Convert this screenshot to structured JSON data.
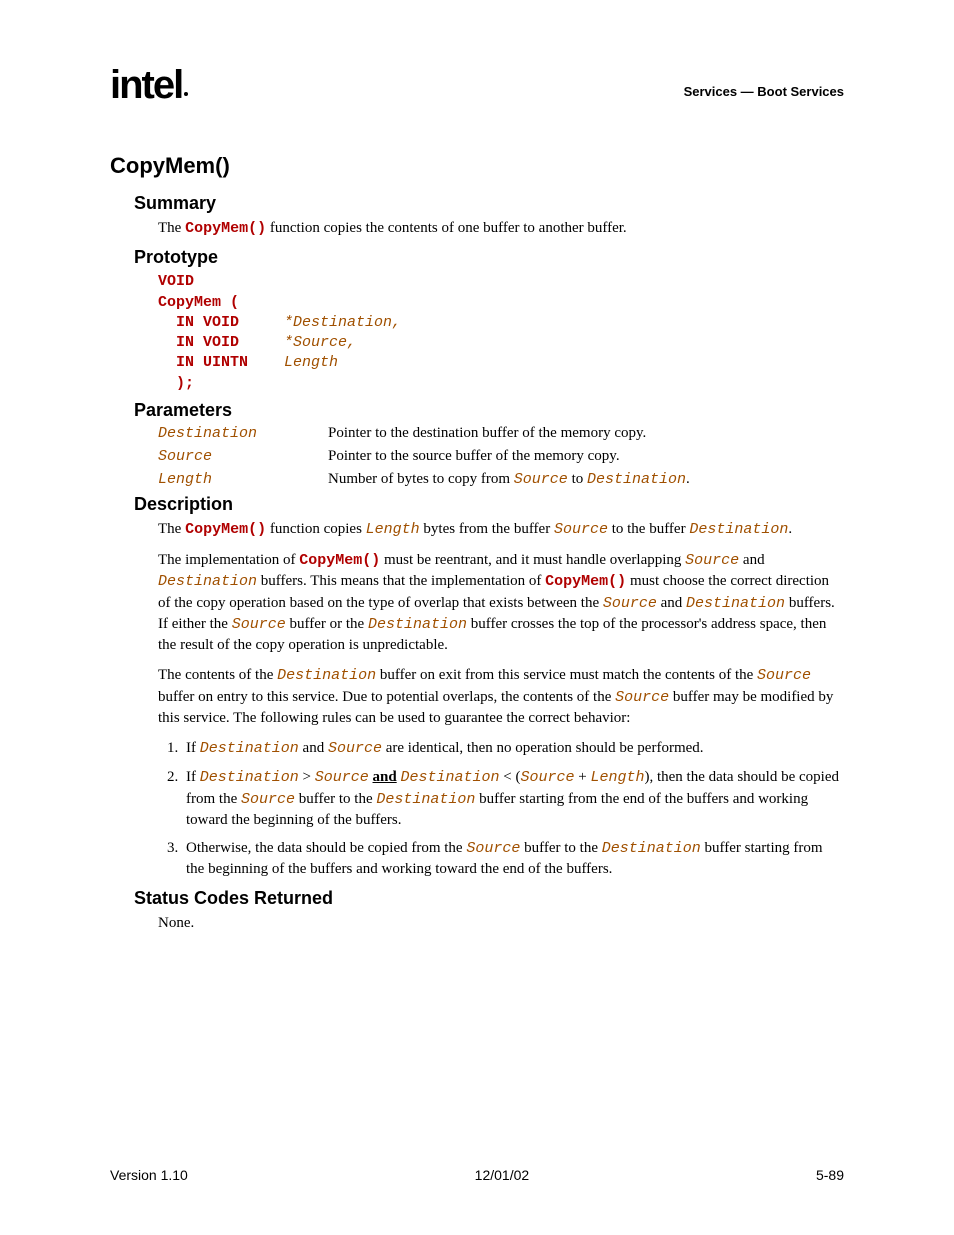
{
  "header": {
    "logo_text": "intel",
    "right_text": "Services — Boot Services"
  },
  "title": "CopyMem()",
  "summary": {
    "heading": "Summary",
    "prefix": "The ",
    "fn": "CopyMem()",
    "suffix": " function copies the contents of one buffer to another buffer."
  },
  "prototype": {
    "heading": "Prototype",
    "l1_kw": "VOID",
    "l2_kw": "CopyMem (",
    "l3_kw": "  IN VOID",
    "l3_id": "*Destination,",
    "l4_kw": "  IN VOID",
    "l4_id": "*Source,",
    "l5_kw": "  IN UINTN",
    "l5_id": "Length",
    "l6_kw": "  );"
  },
  "parameters": {
    "heading": "Parameters",
    "rows": [
      {
        "name": "Destination",
        "desc": "Pointer to the destination buffer of the memory copy."
      },
      {
        "name": "Source",
        "desc": "Pointer to the source buffer of the memory copy."
      },
      {
        "name": "Length",
        "desc_prefix": "Number of bytes to copy from ",
        "a": "Source",
        "mid": " to ",
        "b": "Destination",
        "end": "."
      }
    ]
  },
  "description": {
    "heading": "Description",
    "p1": {
      "t1": "The ",
      "fn": "CopyMem()",
      "t2": " function copies ",
      "len": "Length",
      "t3": " bytes from the buffer ",
      "src": "Source",
      "t4": " to the buffer ",
      "dst": "Destination",
      "t5": "."
    },
    "p2": {
      "t1": "The implementation of ",
      "fn1": "CopyMem()",
      "t2": " must be reentrant, and it must handle overlapping ",
      "src": "Source",
      "t3": " and ",
      "dst": "Destination",
      "t4": " buffers.  This means that the implementation of ",
      "fn2": "CopyMem()",
      "t5": " must choose the correct direction of the copy operation based on the type of overlap that exists between the ",
      "src2": "Source",
      "t6": " and ",
      "dst2": "Destination",
      "t7": " buffers.  If either the ",
      "src3": "Source",
      "t8": " buffer or the ",
      "dst3": "Destination",
      "t9": " buffer crosses the top of the processor's address space, then the result of the copy operation is unpredictable."
    },
    "p3": {
      "t1": "The contents of the ",
      "dst": "Destination",
      "t2": " buffer on exit from this service must match the contents of the ",
      "src": "Source",
      "t3": " buffer on entry to this service.  Due to potential overlaps, the contents of the ",
      "src2": "Source",
      "t4": " buffer may be modified by this service.  The following rules can be used to guarantee the correct behavior:"
    },
    "r1": {
      "t1": "If ",
      "dst": "Destination",
      "t2": " and ",
      "src": "Source",
      "t3": " are identical, then no operation should be performed."
    },
    "r2": {
      "t1": "If ",
      "dst": "Destination",
      "gt": " > ",
      "src": "Source",
      "sp": "  ",
      "and": "and",
      "sp2": " ",
      "dst2": "Destination",
      "lt": " < (",
      "src2": "Source",
      "plus": " + ",
      "len": "Length",
      "t2": "), then the data should be copied from the ",
      "src3": "Source",
      "t3": " buffer to the ",
      "dst3": "Destination",
      "t4": " buffer starting from the end of the buffers and working toward the beginning of the buffers."
    },
    "r3": {
      "t1": "Otherwise, the data should be copied from the ",
      "src": "Source",
      "t2": " buffer to the ",
      "dst": "Destination",
      "t3": " buffer starting from the beginning of the buffers and working toward the end of the buffers."
    }
  },
  "status": {
    "heading": "Status Codes Returned",
    "text": "None."
  },
  "footer": {
    "left": "Version 1.10",
    "center": "12/01/02",
    "right": "5-89"
  }
}
